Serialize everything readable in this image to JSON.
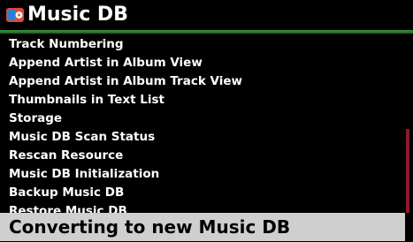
{
  "header": {
    "title": "Music DB",
    "icon": "music-db-app-icon"
  },
  "menu": {
    "items": [
      "Track Numbering",
      "Append Artist in Album View",
      "Append Artist in Album Track View",
      "Thumbnails in Text List",
      "Storage",
      "Music DB Scan Status",
      "Rescan Resource",
      "Music DB Initialization",
      "Backup Music DB",
      "Restore Music DB"
    ],
    "selected": "Converting to new Music DB"
  },
  "colors": {
    "background": "#000000",
    "header_accent": "#2f7f2f",
    "selection": "#cfcfcf",
    "scrollbar": "#8b1a2b"
  }
}
